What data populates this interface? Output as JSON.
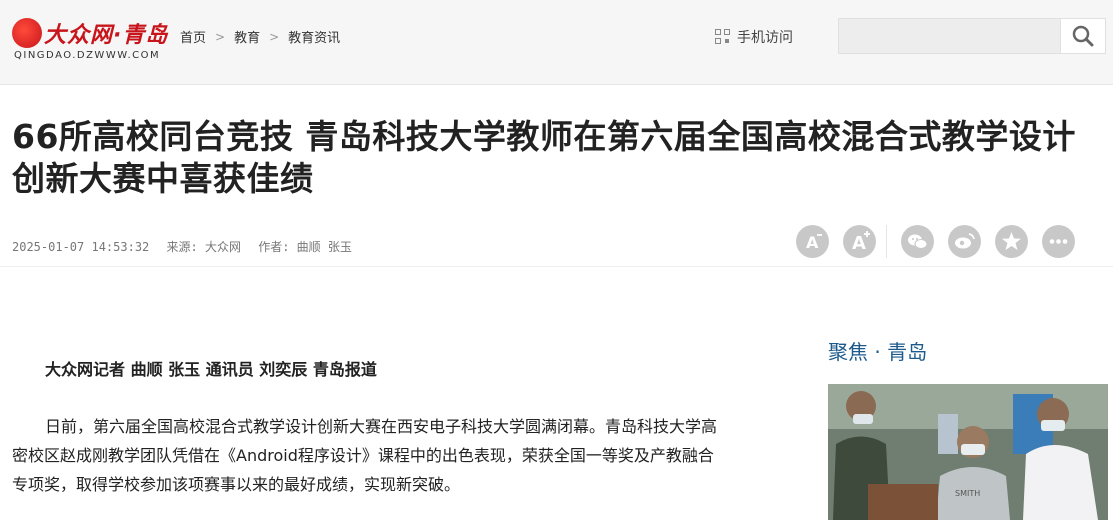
{
  "header": {
    "logo_brand": "大众网·青岛",
    "logo_domain": "QINGDAO.DZWWW.COM",
    "breadcrumb": [
      "首页",
      "教育",
      "教育资讯"
    ],
    "mobile_label": "手机访问",
    "search_placeholder": ""
  },
  "article": {
    "title": "66所高校同台竞技 青岛科技大学教师在第六届全国高校混合式教学设计创新大赛中喜获佳绩",
    "datetime": "2025-01-07 14:53:32",
    "source": "来源: 大众网",
    "author": "作者: 曲顺 张玉",
    "byline": "大众网记者 曲顺 张玉 通讯员 刘奕辰 青岛报道",
    "paragraph1": "日前，第六届全国高校混合式教学设计创新大赛在西安电子科技大学圆满闭幕。青岛科技大学高密校区赵成刚教学团队凭借在《Android程序设计》课程中的出色表现，荣获全国一等奖及产教融合专项奖，取得学校参加该项赛事以来的最好成绩，实现新突破。"
  },
  "tools": [
    "font-decrease-icon",
    "font-increase-icon",
    "wechat-icon",
    "weibo-icon",
    "favorite-icon",
    "more-icon"
  ],
  "sidebar": {
    "title": "聚焦 · 青岛"
  },
  "colors": {
    "brand_red": "#c8151b",
    "sidebar_title": "#1d5a8c",
    "tool_gray": "#c8c8c8"
  }
}
